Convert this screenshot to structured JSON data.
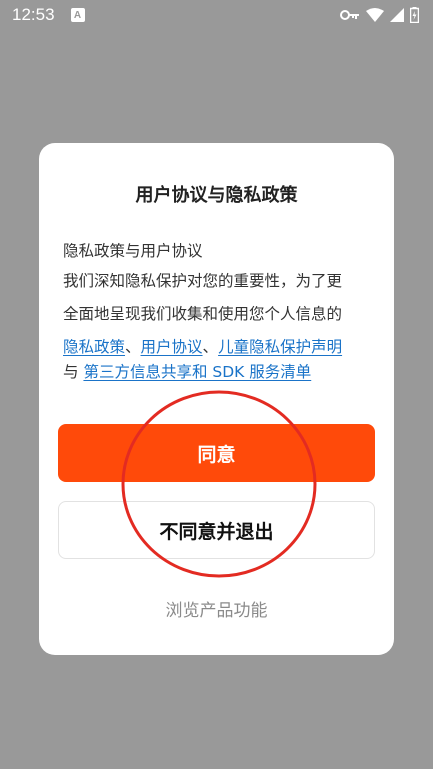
{
  "status_bar": {
    "time": "12:53",
    "notification_icon_letter": "A",
    "icons": [
      "key-icon",
      "wifi-icon",
      "signal-icon",
      "battery-icon"
    ]
  },
  "dialog": {
    "title": "用户协议与隐私政策",
    "line1": "隐私政策与用户协议",
    "line2": "我们深知隐私保护对您的重要性，为了更",
    "line3": "全面地呈现我们收集和使用您个人信息的",
    "links": {
      "privacy_policy": "隐私政策",
      "separator": "、",
      "user_agreement": "用户协议",
      "children_privacy": "儿童隐私保护声明",
      "and": "与 ",
      "third_party": "第三方信息共享和 SDK 服务清单"
    },
    "agree_label": "同意",
    "disagree_label": "不同意并退出",
    "browse_label": "浏览产品功能"
  },
  "colors": {
    "overlay": "#999999",
    "accent": "#ff4a0a",
    "link": "#1a73c8",
    "annotation": "#e32b22"
  }
}
